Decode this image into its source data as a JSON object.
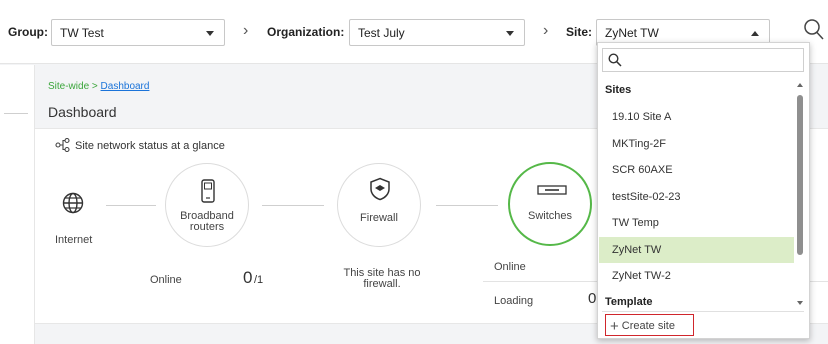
{
  "topbar": {
    "group_label": "Group:",
    "group_value": "TW Test",
    "org_label": "Organization:",
    "org_value": "Test July",
    "site_label": "Site:",
    "site_value": "ZyNet TW",
    "chevron": "›"
  },
  "main": {
    "breadcrumb_prefix": "Site-wide >",
    "breadcrumb_link": "Dashboard",
    "title": "Dashboard",
    "card_title": "Site network status at a glance"
  },
  "topology": {
    "internet": "Internet",
    "broadband_line1": "Broadband",
    "broadband_line2": "routers",
    "firewall": "Firewall",
    "switches": "Switches"
  },
  "stats": {
    "online_label": "Online",
    "online_value": "0",
    "online_total": "/1",
    "firewall_line1": "This site has no",
    "firewall_line2": "firewall.",
    "sw_online_label": "Online",
    "sw_loading_label": "Loading",
    "sw_loading_value": "0"
  },
  "dropdown": {
    "search_placeholder": "",
    "group_sites": "Sites",
    "items": [
      "19.10 Site A",
      "MKTing-2F",
      "SCR 60AXE",
      "testSite-02-23",
      "TW Temp",
      "ZyNet TW",
      "ZyNet TW-2"
    ],
    "selected": "ZyNet TW",
    "group_template": "Template",
    "create_label": "Create site"
  },
  "colors": {
    "accent_green": "#55b848",
    "selected_bg": "#dcedc8",
    "link_blue": "#1a73d9",
    "highlight_red": "#d0262c"
  }
}
